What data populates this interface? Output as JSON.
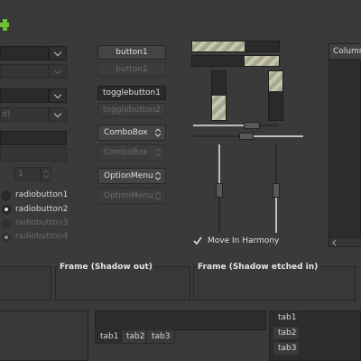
{
  "buttons": {
    "button1": "button1",
    "button2": "button2",
    "togglebutton1": "togglebutton1",
    "togglebutton2": "togglebutton2"
  },
  "combos": {
    "combobox1": "ComboBox",
    "combobox2": "ComboBox",
    "optionmenu1": "OptionMenu",
    "optionmenu2": "OptionMenu"
  },
  "entries": {
    "partial_text": "d)"
  },
  "spin": {
    "value": "1"
  },
  "radios": [
    {
      "label": "radiobutton1",
      "selected": false,
      "disabled": false
    },
    {
      "label": "radiobutton2",
      "selected": true,
      "disabled": false
    },
    {
      "label": "radiobutton3",
      "selected": false,
      "disabled": true
    },
    {
      "label": "radiobutton4",
      "selected": true,
      "disabled": true
    }
  ],
  "progress": {
    "h1": 0.6,
    "h2": 0.4,
    "v1": 0.5,
    "v2": 0.4
  },
  "checkbox": {
    "label": "Move In Harmony",
    "checked": true
  },
  "tree": {
    "column_header": "Column"
  },
  "frames": {
    "shadow_out": "Frame (Shadow out)",
    "shadow_etched_in": "Frame (Shadow etched in)"
  },
  "tabs_bottom": [
    "tab1",
    "tab2",
    "tab3"
  ],
  "tabs_left": [
    "tab1",
    "tab2",
    "tab3"
  ],
  "colors": {
    "background": "#3a3a3a",
    "progress_fill": "#b4b59c",
    "plus_icon": "#6fc22e"
  }
}
